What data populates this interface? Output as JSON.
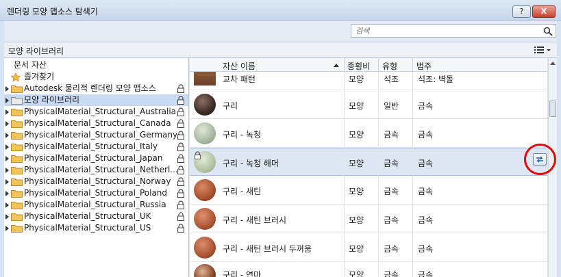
{
  "window": {
    "title": "렌더링 모양 맵소스 탐색기",
    "help_label": "?",
    "close_label": "X"
  },
  "search": {
    "placeholder": "검색"
  },
  "library": {
    "title": "모양 라이브러리"
  },
  "tree": {
    "items": [
      {
        "label": "문서 자산"
      },
      {
        "label": "즐겨찾기"
      },
      {
        "label": "Autodesk 물리적 렌더링 모양 맵소스"
      },
      {
        "label": "모양 라이브러리"
      },
      {
        "label": "PhysicalMaterial_Structural_Australia"
      },
      {
        "label": "PhysicalMaterial_Structural_Canada"
      },
      {
        "label": "PhysicalMaterial_Structural_Germany"
      },
      {
        "label": "PhysicalMaterial_Structural_Italy"
      },
      {
        "label": "PhysicalMaterial_Structural_Japan"
      },
      {
        "label": "PhysicalMaterial_Structural_Netherl..."
      },
      {
        "label": "PhysicalMaterial_Structural_Norway"
      },
      {
        "label": "PhysicalMaterial_Structural_Poland"
      },
      {
        "label": "PhysicalMaterial_Structural_Russia"
      },
      {
        "label": "PhysicalMaterial_Structural_UK"
      },
      {
        "label": "PhysicalMaterial_Structural_US"
      }
    ]
  },
  "grid": {
    "columns": {
      "name": "자산 이름",
      "kind": "종횡비",
      "type": "유형",
      "category": "범주"
    },
    "rows": [
      {
        "name": "교차 패턴",
        "kind": "모양",
        "type": "석조",
        "category": "석조: 벽돌"
      },
      {
        "name": "구리",
        "kind": "모양",
        "type": "일반",
        "category": "금속"
      },
      {
        "name": "구리 - 녹청",
        "kind": "모양",
        "type": "금속",
        "category": "금속"
      },
      {
        "name": "구리 - 녹청 해머",
        "kind": "모양",
        "type": "금속",
        "category": "금속"
      },
      {
        "name": "구리 - 새틴",
        "kind": "모양",
        "type": "금속",
        "category": "금속"
      },
      {
        "name": "구리 - 새틴 브러시",
        "kind": "모양",
        "type": "금속",
        "category": "금속"
      },
      {
        "name": "구리 - 새틴 브러시 두꺼움",
        "kind": "모양",
        "type": "금속",
        "category": "금속"
      },
      {
        "name": "구리 - 연마",
        "kind": "모양",
        "type": "금속",
        "category": "금속"
      }
    ]
  },
  "colors": {
    "accent": "#c7daf2",
    "annotation": "#e00b0b",
    "folder": "#f2c55c"
  }
}
